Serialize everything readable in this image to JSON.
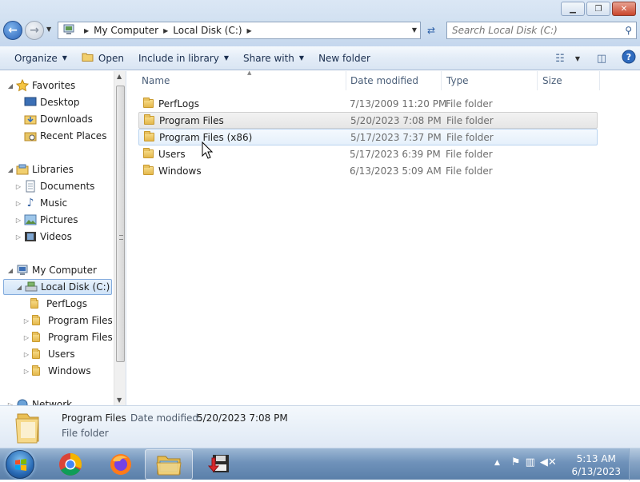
{
  "window": {
    "minimize_glyph": "▁",
    "maximize_glyph": "❐",
    "close_glyph": "✕"
  },
  "address": {
    "crumbs": [
      "My Computer",
      "Local Disk (C:)"
    ]
  },
  "search": {
    "placeholder": "Search Local Disk (C:)"
  },
  "toolbar": {
    "organize": "Organize",
    "open": "Open",
    "include_in_library": "Include in library",
    "share_with": "Share with",
    "new_folder": "New folder"
  },
  "nav": {
    "favorites": "Favorites",
    "desktop": "Desktop",
    "downloads": "Downloads",
    "recent_places": "Recent Places",
    "libraries": "Libraries",
    "documents": "Documents",
    "music": "Music",
    "pictures": "Pictures",
    "videos": "Videos",
    "my_computer": "My Computer",
    "local_disk": "Local Disk (C:)",
    "perflogs": "PerfLogs",
    "program_files": "Program Files",
    "program_files_x86": "Program Files (",
    "users": "Users",
    "windows": "Windows",
    "network": "Network"
  },
  "columns": {
    "name": "Name",
    "date_modified": "Date modified",
    "type": "Type",
    "size": "Size"
  },
  "files": [
    {
      "name": "PerfLogs",
      "date": "7/13/2009 11:20 PM",
      "type": "File folder"
    },
    {
      "name": "Program Files",
      "date": "5/20/2023 7:08 PM",
      "type": "File folder"
    },
    {
      "name": "Program Files (x86)",
      "date": "5/17/2023 7:37 PM",
      "type": "File folder"
    },
    {
      "name": "Users",
      "date": "5/17/2023 6:39 PM",
      "type": "File folder"
    },
    {
      "name": "Windows",
      "date": "6/13/2023 5:09 AM",
      "type": "File folder"
    }
  ],
  "details": {
    "name": "Program Files",
    "date_label": "Date modified:",
    "date_value": "5/20/2023 7:08 PM",
    "type": "File folder"
  },
  "taskbar": {
    "time": "5:13 AM",
    "date": "6/13/2023"
  },
  "colors": {
    "selection_border": "#84acdd",
    "hover_border": "#b9d3ef",
    "taskbar": "#6f92ba"
  }
}
